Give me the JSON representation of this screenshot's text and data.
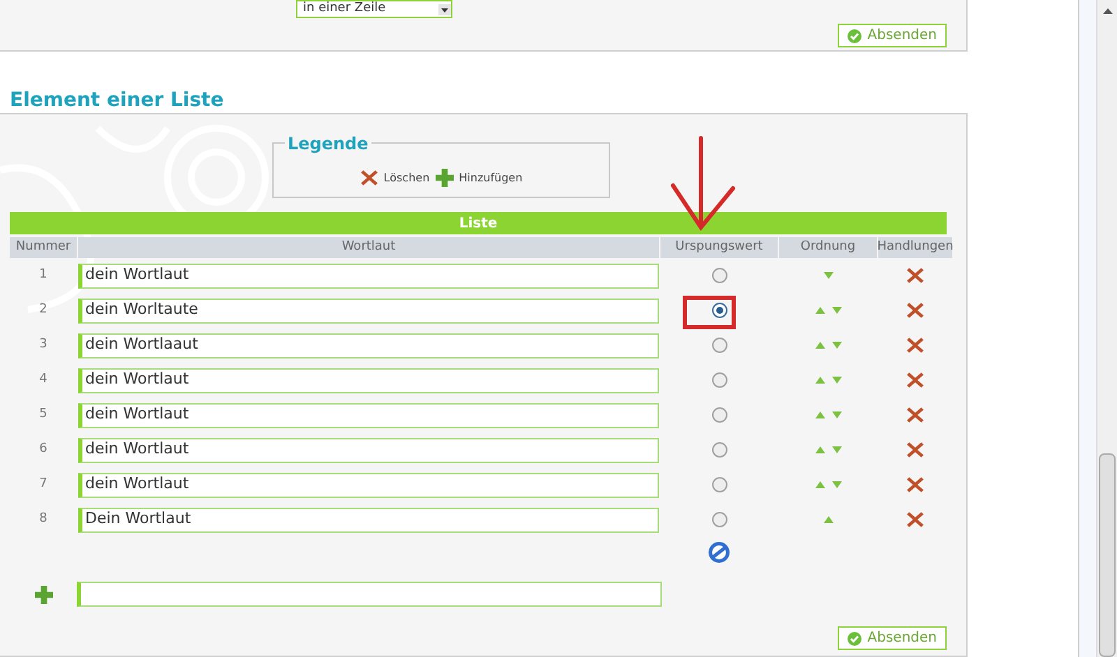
{
  "top_form": {
    "select": {
      "value": "in einer Zeile"
    },
    "submit": "Absenden"
  },
  "section": {
    "title": "Element einer Liste",
    "legend": {
      "title": "Legende",
      "delete": "Löschen",
      "add": "Hinzufügen"
    },
    "table": {
      "title": "Liste",
      "columns": [
        "Nummer",
        "Wortlaut",
        "Urspungswert",
        "Ordnung",
        "Handlungen"
      ],
      "rows": [
        {
          "number": "1",
          "text": "dein Wortlaut",
          "selected": false,
          "up": false,
          "down": true
        },
        {
          "number": "2",
          "text": "dein Worltaute",
          "selected": true,
          "up": true,
          "down": true
        },
        {
          "number": "3",
          "text": "dein Wortlaaut",
          "selected": false,
          "up": true,
          "down": true
        },
        {
          "number": "4",
          "text": "dein Wortlaut",
          "selected": false,
          "up": true,
          "down": true
        },
        {
          "number": "5",
          "text": "dein Wortlaut",
          "selected": false,
          "up": true,
          "down": true
        },
        {
          "number": "6",
          "text": "dein Wortlaut",
          "selected": false,
          "up": true,
          "down": true
        },
        {
          "number": "7",
          "text": "dein Wortlaut",
          "selected": false,
          "up": true,
          "down": true
        },
        {
          "number": "8",
          "text": "Dein Wortlaut",
          "selected": false,
          "up": true,
          "down": false
        }
      ]
    },
    "submit": "Absenden"
  }
}
